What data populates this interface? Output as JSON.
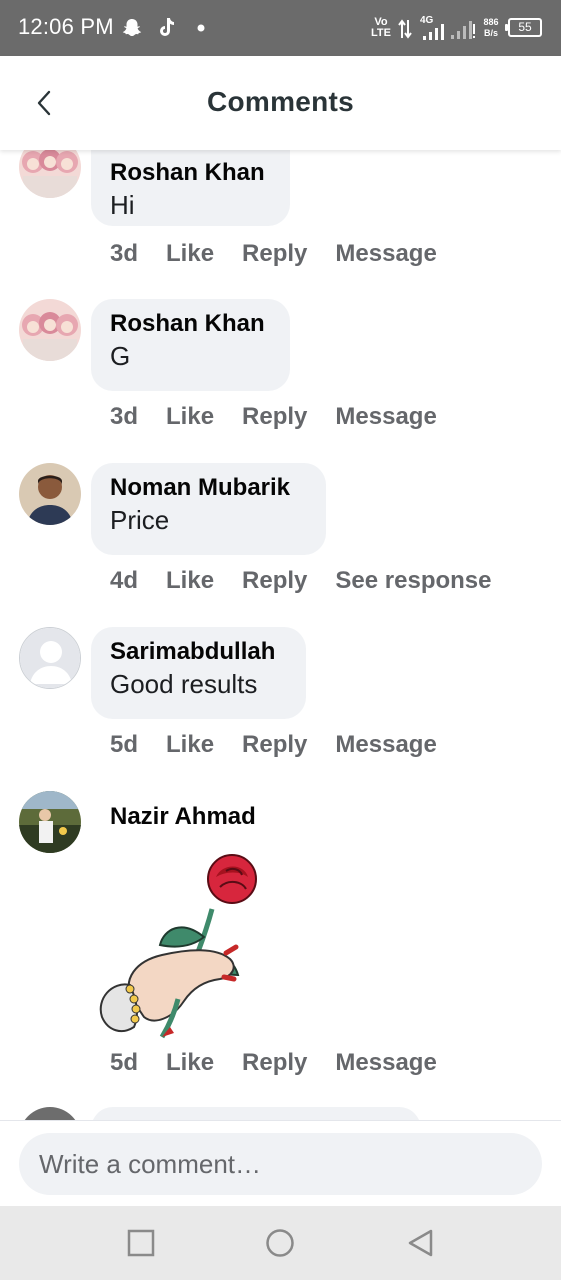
{
  "status_bar": {
    "time": "12:06 PM",
    "volte_top": "Vo",
    "volte_bottom": "LTE",
    "network": "4G",
    "speed_value": "886",
    "speed_unit": "B/s",
    "battery": "55",
    "icons": [
      "snapchat-icon",
      "tiktok-icon",
      "notification-dot-icon",
      "data-arrows-icon",
      "signal-icon",
      "signal-icon-2",
      "battery-icon"
    ]
  },
  "header": {
    "title": "Comments",
    "back_icon": "back-arrow-icon"
  },
  "comments": [
    {
      "author": "Roshan Khan",
      "text": "Hi",
      "time": "3d",
      "like": "Like",
      "reply": "Reply",
      "extra": "Message"
    },
    {
      "author": "Roshan Khan",
      "text": "G",
      "time": "3d",
      "like": "Like",
      "reply": "Reply",
      "extra": "Message"
    },
    {
      "author": "Noman Mubarik",
      "text": "Price",
      "time": "4d",
      "like": "Like",
      "reply": "Reply",
      "extra": "See response"
    },
    {
      "author": "Sarimabdullah",
      "text": "Good results",
      "time": "5d",
      "like": "Like",
      "reply": "Reply",
      "extra": "Message"
    },
    {
      "author": "Nazir Ahmad",
      "sticker": "rose-in-hand-sticker",
      "time": "5d",
      "like": "Like",
      "reply": "Reply",
      "extra": "Message"
    }
  ],
  "composer": {
    "placeholder": "Write a comment…"
  },
  "nav_bar": {
    "icons": [
      "recents-square-icon",
      "home-circle-icon",
      "back-triangle-icon"
    ]
  },
  "colors": {
    "status_bar": "#6b6b6b",
    "bubble": "#f0f2f5",
    "secondary_text": "#65676b",
    "title": "#2a3438",
    "nav_bar": "#e9e9e9"
  }
}
